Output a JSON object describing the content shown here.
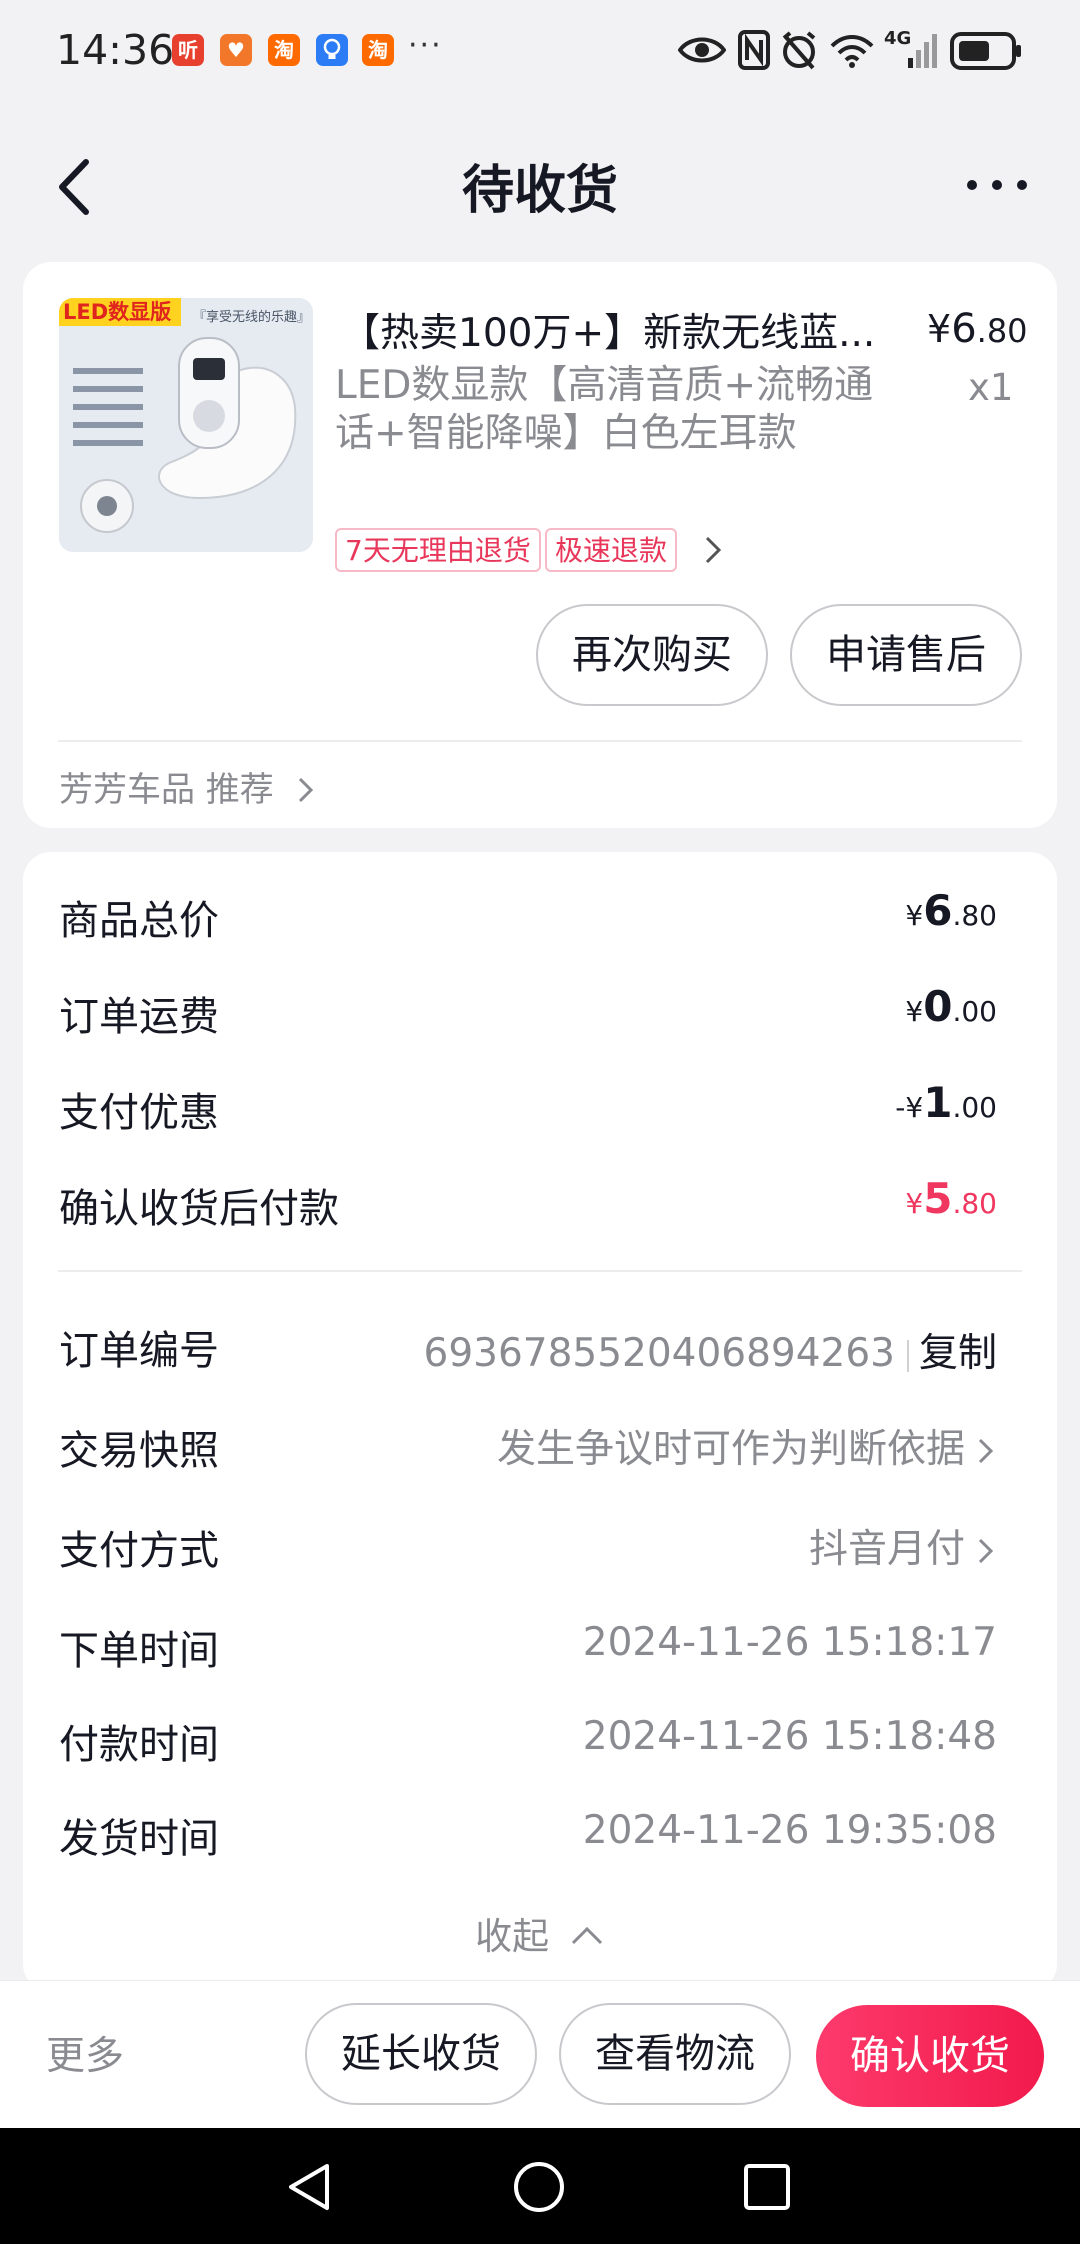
{
  "status_bar": {
    "time": "14:36",
    "apps": [
      {
        "icon": "ting-app-icon",
        "glyph": "听",
        "color": "#e8402e"
      },
      {
        "icon": "heart-app-icon",
        "glyph": "♥",
        "color": "#f2772a"
      },
      {
        "icon": "taobao-app-icon",
        "glyph": "淘",
        "color": "#ff6a00"
      },
      {
        "icon": "lightbulb-app-icon",
        "glyph": "💡",
        "color": "#2c7cf6"
      },
      {
        "icon": "taobao-app-icon-2",
        "glyph": "淘",
        "color": "#ff6a00"
      }
    ],
    "overflow": "···",
    "network": "4G"
  },
  "nav": {
    "title": "待收货"
  },
  "product": {
    "thumb_badge": "LED数显版",
    "thumb_caption": "『享受无线的乐趣』",
    "title": "【热卖100万+】新款无线蓝...",
    "price_symbol": "¥",
    "price_int": "6",
    "price_dec": ".80",
    "spec": "LED数显款【高清音质+流畅通话+智能降噪】白色左耳款",
    "qty": "x1",
    "tags": [
      "7天无理由退货",
      "极速退款"
    ],
    "buttons": {
      "rebuy": "再次购买",
      "after_sale": "申请售后"
    },
    "shop_recommend": "芳芳车品 推荐"
  },
  "summary": {
    "rows": [
      {
        "label": "商品总价",
        "prefix": "",
        "int": "6",
        "dec": ".80"
      },
      {
        "label": "订单运费",
        "prefix": "",
        "int": "0",
        "dec": ".00"
      },
      {
        "label": "支付优惠",
        "prefix": "-",
        "int": "1",
        "dec": ".00"
      },
      {
        "label": "确认收货后付款",
        "prefix": "",
        "int": "5",
        "dec": ".80"
      }
    ],
    "yen": "¥",
    "order_no_label": "订单编号",
    "order_no": "6936785520406894263",
    "copy": "复制",
    "snapshot_label": "交易快照",
    "snapshot_value": "发生争议时可作为判断依据",
    "pay_method_label": "支付方式",
    "pay_method_value": "抖音月付",
    "order_time_label": "下单时间",
    "order_time": "2024-11-26 15:18:17",
    "pay_time_label": "付款时间",
    "pay_time": "2024-11-26 15:18:48",
    "ship_time_label": "发货时间",
    "ship_time": "2024-11-26 19:35:08",
    "collapse": "收起"
  },
  "bottom": {
    "more": "更多",
    "extend": "延长收货",
    "logistics": "查看物流",
    "confirm": "确认收货"
  },
  "colors": {
    "accent": "#f0375f",
    "confirm_gradient": [
      "#fd3a6c",
      "#f21a4c"
    ]
  }
}
